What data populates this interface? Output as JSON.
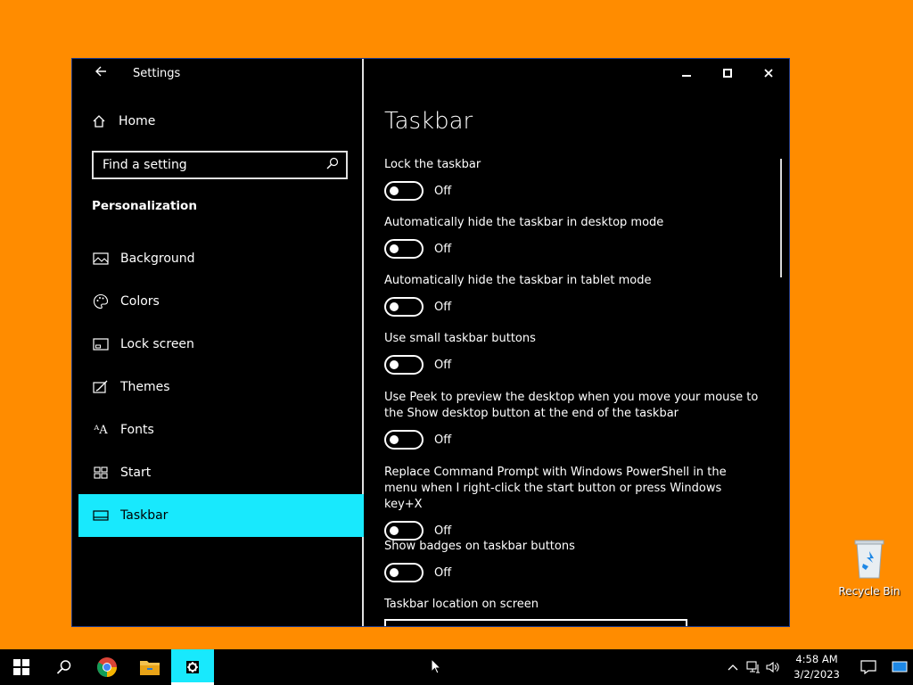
{
  "window": {
    "title": "Settings",
    "home_label": "Home",
    "search_placeholder": "Find a setting",
    "section_label": "Personalization",
    "nav": [
      {
        "label": "Background",
        "icon": "image-icon"
      },
      {
        "label": "Colors",
        "icon": "palette-icon"
      },
      {
        "label": "Lock screen",
        "icon": "lock-screen-icon"
      },
      {
        "label": "Themes",
        "icon": "themes-icon"
      },
      {
        "label": "Fonts",
        "icon": "fonts-icon"
      },
      {
        "label": "Start",
        "icon": "start-icon"
      },
      {
        "label": "Taskbar",
        "icon": "taskbar-icon",
        "active": true
      }
    ],
    "page_title": "Taskbar",
    "settings": [
      {
        "label": "Lock the taskbar",
        "state": "Off"
      },
      {
        "label": "Automatically hide the taskbar in desktop mode",
        "state": "Off"
      },
      {
        "label": "Automatically hide the taskbar in tablet mode",
        "state": "Off"
      },
      {
        "label": "Use small taskbar buttons",
        "state": "Off"
      },
      {
        "label": "Use Peek to preview the desktop when you move your mouse to the Show desktop button at the end of the taskbar",
        "state": "Off"
      },
      {
        "label": "Replace Command Prompt with Windows PowerShell in the menu when I right-click the start button or press Windows key+X",
        "state": "Off"
      },
      {
        "label": "Show badges on taskbar buttons",
        "state": "Off"
      }
    ],
    "location_label": "Taskbar location on screen"
  },
  "desktop": {
    "recycle_bin_label": "Recycle Bin"
  },
  "taskbar": {
    "time": "4:58 AM",
    "date": "3/2/2023"
  },
  "colors": {
    "desktop": "#ff8c00",
    "accent": "#18e9fd",
    "window_bg": "#000000"
  }
}
